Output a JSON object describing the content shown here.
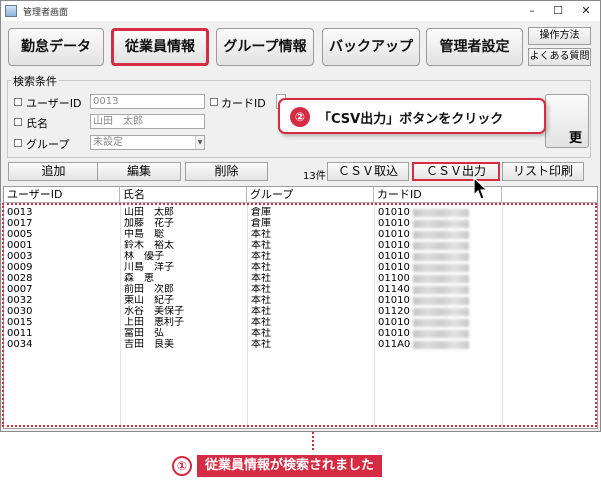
{
  "window": {
    "title": "管理者画面",
    "controls": [
      "–",
      "☐",
      "✕"
    ]
  },
  "nav": [
    {
      "label": "勤怠データ",
      "active": false
    },
    {
      "label": "従業員情報",
      "active": true
    },
    {
      "label": "グループ情報",
      "active": false
    },
    {
      "label": "バックアップ",
      "active": false
    },
    {
      "label": "管理者設定",
      "active": false
    }
  ],
  "side_buttons": {
    "manual": "操作方法",
    "faq": "よくある質問"
  },
  "search": {
    "legend": "検索条件",
    "user_id_label": "ユーザーID",
    "user_id_value": "0013",
    "card_id_label": "カードID",
    "name_label": "氏名",
    "name_value": "山田　太郎",
    "group_label": "グループ",
    "group_value": "未設定",
    "partial_button_label": "更"
  },
  "actions": {
    "add": "追加",
    "edit": "編集",
    "delete": "削除",
    "count": "13件",
    "csv_import": "ＣＳＶ取込",
    "csv_export": "ＣＳＶ出力",
    "print_list": "リスト印刷"
  },
  "table": {
    "headers": [
      "ユーザーID",
      "氏名",
      "グループ",
      "カードID"
    ],
    "rows": [
      {
        "id": "0013",
        "name": "山田　太郎",
        "group": "倉庫",
        "card": "01010"
      },
      {
        "id": "0017",
        "name": "加藤　花子",
        "group": "倉庫",
        "card": "01010"
      },
      {
        "id": "0005",
        "name": "中島　聡",
        "group": "本社",
        "card": "01010"
      },
      {
        "id": "0001",
        "name": "鈴木　裕太",
        "group": "本社",
        "card": "01010"
      },
      {
        "id": "0003",
        "name": "林　優子",
        "group": "本社",
        "card": "01010"
      },
      {
        "id": "0009",
        "name": "川島　洋子",
        "group": "本社",
        "card": "01010"
      },
      {
        "id": "0028",
        "name": "森　恵",
        "group": "本社",
        "card": "01100"
      },
      {
        "id": "0007",
        "name": "前田　次郎",
        "group": "本社",
        "card": "01140"
      },
      {
        "id": "0032",
        "name": "東山　紀子",
        "group": "本社",
        "card": "01010"
      },
      {
        "id": "0030",
        "name": "水谷　美保子",
        "group": "本社",
        "card": "01120"
      },
      {
        "id": "0015",
        "name": "上田　恵利子",
        "group": "本社",
        "card": "01010"
      },
      {
        "id": "0011",
        "name": "富田　弘",
        "group": "本社",
        "card": "01010"
      },
      {
        "id": "0034",
        "name": "吉田　良美",
        "group": "本社",
        "card": "011A0"
      }
    ]
  },
  "annotations": {
    "step1_number": "①",
    "step1_text": "従業員情報が検索されました",
    "step2_number": "②",
    "step2_text": "「CSV出力」ボタンをクリック"
  },
  "colors": {
    "accent": "#d52b43",
    "window_bg": "#f0f0f0"
  }
}
